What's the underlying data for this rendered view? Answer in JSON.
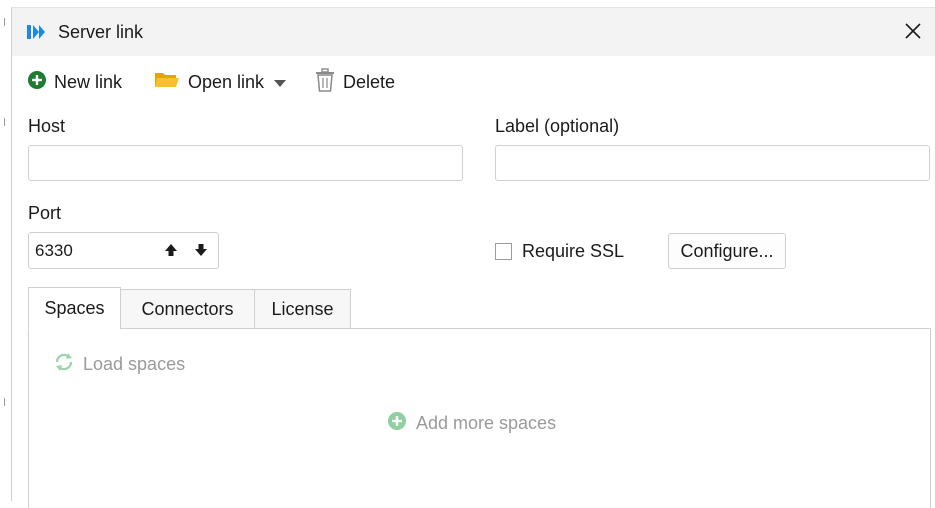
{
  "window": {
    "title": "Server link"
  },
  "toolbar": {
    "new_link": "New link",
    "open_link": "Open link",
    "delete": "Delete"
  },
  "form": {
    "host_label": "Host",
    "host_value": "",
    "label_label": "Label (optional)",
    "label_value": "",
    "port_label": "Port",
    "port_value": "6330",
    "require_ssl_label": "Require SSL",
    "require_ssl_checked": false,
    "configure_label": "Configure..."
  },
  "tabs": [
    {
      "label": "Spaces",
      "active": true
    },
    {
      "label": "Connectors",
      "active": false
    },
    {
      "label": "License",
      "active": false
    }
  ],
  "spaces_panel": {
    "load_spaces": "Load spaces",
    "add_more_spaces": "Add more spaces"
  },
  "colors": {
    "accent_blue": "#1e88e5",
    "add_green": "#1e7d32",
    "folder_yellow": "#f4b400",
    "disabled_gray": "#9a9a9a",
    "disabled_green": "#8fd0a0"
  },
  "icons": {
    "app": "server-link-app-icon",
    "close": "close-icon",
    "new": "plus-circle-icon",
    "open": "folder-icon",
    "open_menu": "caret-down-icon",
    "delete": "trash-icon",
    "spin_up": "arrow-up-icon",
    "spin_down": "arrow-down-icon",
    "load": "refresh-icon",
    "add": "plus-circle-icon"
  }
}
